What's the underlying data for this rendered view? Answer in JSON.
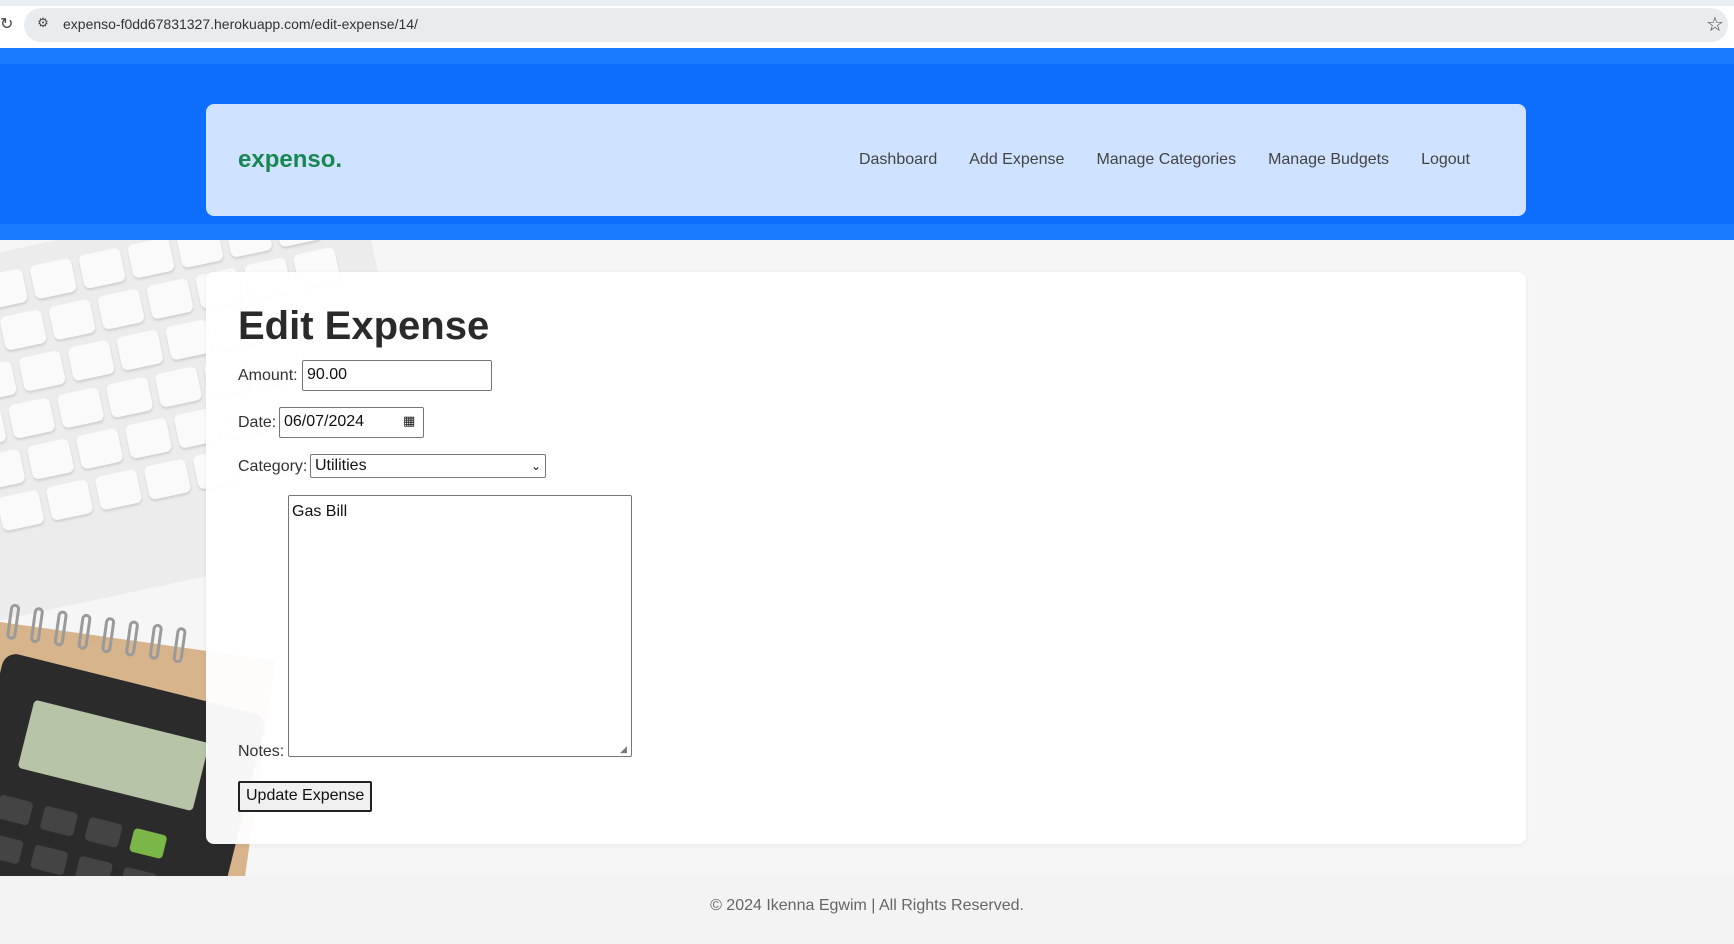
{
  "browser": {
    "url": "expenso-f0dd67831327.herokuapp.com/edit-expense/14/",
    "icons": [
      "reload-icon",
      "site-settings-icon",
      "bookmark-star-icon"
    ]
  },
  "navbar": {
    "brand": "expenso.",
    "links": [
      "Dashboard",
      "Add Expense",
      "Manage Categories",
      "Manage Budgets",
      "Logout"
    ]
  },
  "form": {
    "title": "Edit Expense",
    "amount_label": "Amount:",
    "amount_value": "90.00",
    "date_label": "Date:",
    "date_value": "06/07/2024",
    "category_label": "Category:",
    "category_value": "Utilities",
    "notes_label": "Notes:",
    "notes_value": "Gas Bill",
    "submit_label": "Update Expense"
  },
  "footer": {
    "text": "© 2024 Ikenna Egwim | All Rights Reserved."
  },
  "colors": {
    "header": "#0d6efd",
    "navbar": "#cfe2ff",
    "brand": "#198754"
  }
}
